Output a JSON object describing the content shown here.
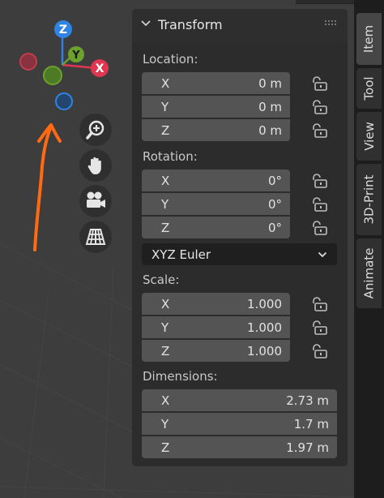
{
  "gizmo": {
    "z_label": "Z",
    "y_label": "Y",
    "x_label": "X",
    "colors": {
      "x": "#e0364f",
      "y": "#6ca12c",
      "z": "#2f84e3"
    }
  },
  "nav_icons": [
    "zoom-icon",
    "hand-pan-icon",
    "camera-icon",
    "perspective-grid-icon"
  ],
  "annotation": {
    "color": "#ff6a13",
    "icon": "hand-drawn-arrow"
  },
  "panel": {
    "title": "Transform",
    "location": {
      "label": "Location:",
      "rows": [
        {
          "axis": "X",
          "value": "0 m"
        },
        {
          "axis": "Y",
          "value": "0 m"
        },
        {
          "axis": "Z",
          "value": "0 m"
        }
      ]
    },
    "rotation": {
      "label": "Rotation:",
      "rows": [
        {
          "axis": "X",
          "value": "0°"
        },
        {
          "axis": "Y",
          "value": "0°"
        },
        {
          "axis": "Z",
          "value": "0°"
        }
      ],
      "mode": "XYZ Euler"
    },
    "scale": {
      "label": "Scale:",
      "rows": [
        {
          "axis": "X",
          "value": "1.000"
        },
        {
          "axis": "Y",
          "value": "1.000"
        },
        {
          "axis": "Z",
          "value": "1.000"
        }
      ]
    },
    "dimensions": {
      "label": "Dimensions:",
      "rows": [
        {
          "axis": "X",
          "value": "2.73 m"
        },
        {
          "axis": "Y",
          "value": "1.7 m"
        },
        {
          "axis": "Z",
          "value": "1.97 m"
        }
      ]
    }
  },
  "tabs": [
    {
      "label": "Item",
      "active": true
    },
    {
      "label": "Tool",
      "active": false
    },
    {
      "label": "View",
      "active": false
    },
    {
      "label": "3D-Print",
      "active": false
    },
    {
      "label": "Animate",
      "active": false
    }
  ]
}
